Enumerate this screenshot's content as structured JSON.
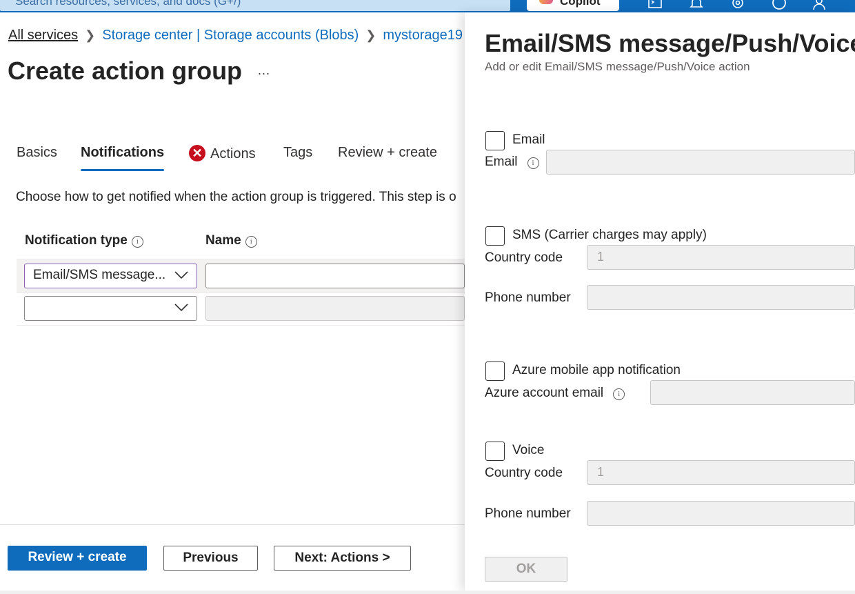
{
  "topbar": {
    "search_placeholder": "Search resources, services, and docs (G+/)",
    "copilot_label": "Copilot",
    "icons": [
      "cloud-shell-icon",
      "notifications-icon",
      "settings-icon",
      "help-icon",
      "account-icon"
    ]
  },
  "breadcrumb": {
    "items": [
      "All services",
      "Storage center | Storage accounts (Blobs)",
      "mystorage19"
    ]
  },
  "page": {
    "title": "Create action group",
    "more_label": "..."
  },
  "tabs": [
    {
      "label": "Basics",
      "active": false,
      "error": false
    },
    {
      "label": "Notifications",
      "active": true,
      "error": false
    },
    {
      "label": "Actions",
      "active": false,
      "error": true
    },
    {
      "label": "Tags",
      "active": false,
      "error": false
    },
    {
      "label": "Review + create",
      "active": false,
      "error": false
    }
  ],
  "description": "Choose how to get notified when the action group is triggered. This step is o",
  "table": {
    "headers": [
      "Notification type",
      "Name"
    ],
    "rows": [
      {
        "type": "Email/SMS message...",
        "name": ""
      },
      {
        "type": "",
        "name": ""
      }
    ]
  },
  "footer": {
    "review_create": "Review + create",
    "previous": "Previous",
    "next": "Next: Actions >"
  },
  "panel": {
    "title": "Email/SMS message/Push/Voice",
    "subtitle": "Add or edit Email/SMS message/Push/Voice action",
    "email": {
      "checkbox_label": "Email",
      "field_label": "Email",
      "value": ""
    },
    "sms": {
      "checkbox_label": "SMS (Carrier charges may apply)",
      "country_code_label": "Country code",
      "country_code_value": "1",
      "phone_label": "Phone number",
      "phone_value": ""
    },
    "push": {
      "checkbox_label": "Azure mobile app notification",
      "field_label": "Azure account email",
      "value": ""
    },
    "voice": {
      "checkbox_label": "Voice",
      "country_code_label": "Country code",
      "country_code_value": "1",
      "phone_label": "Phone number",
      "phone_value": ""
    },
    "ok_label": "OK"
  },
  "colors": {
    "accent": "#0f6cbd",
    "error": "#c50f1f",
    "dropdown_focus": "#8764b8"
  }
}
